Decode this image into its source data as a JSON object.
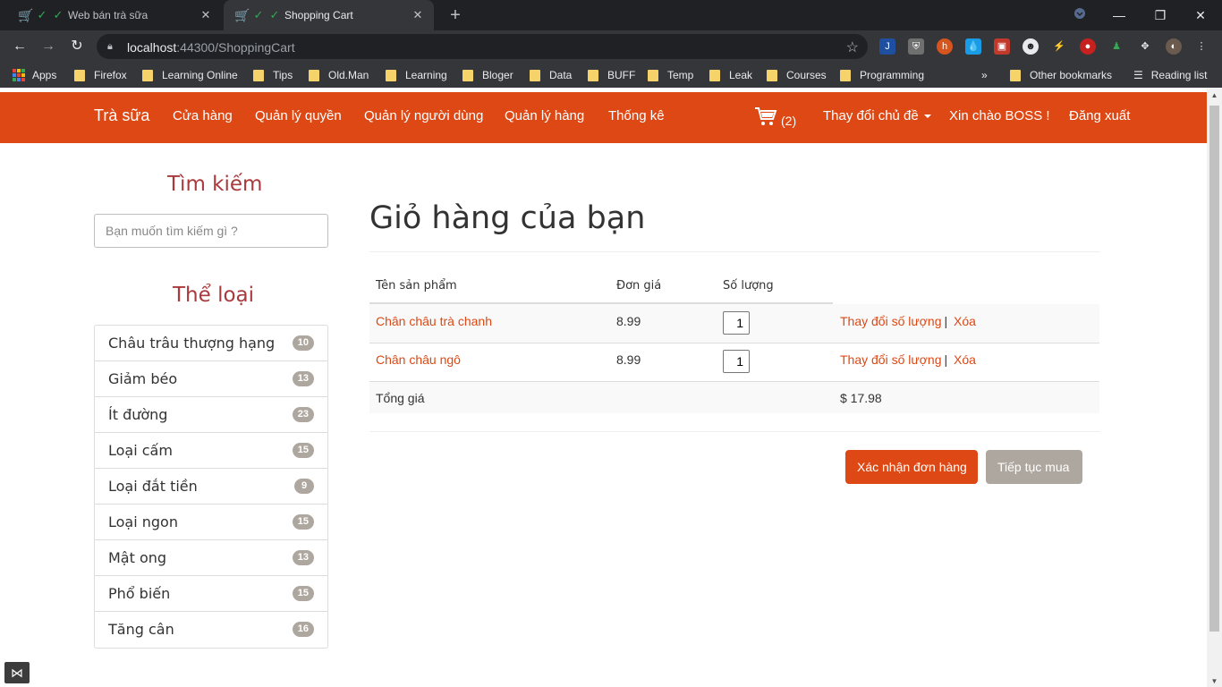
{
  "browser": {
    "tabs": [
      {
        "title": "Web bán trà sữa",
        "active": false
      },
      {
        "title": "Shopping Cart",
        "active": true
      }
    ],
    "url_host": "localhost",
    "url_path": ":44300/ShoppingCart",
    "bookmarks": [
      "Apps",
      "Firefox",
      "Learning Online",
      "Tips",
      "Old.Man",
      "Learning",
      "Bloger",
      "Data",
      "BUFF",
      "Temp",
      "Leak",
      "Courses",
      "Programming"
    ],
    "more_bookmarks": "»",
    "other_bookmarks": "Other bookmarks",
    "reading_list": "Reading list"
  },
  "navbar": {
    "brand": "Trà sữa",
    "links": [
      "Cửa hàng",
      "Quản lý quyền",
      "Quản lý người dùng",
      "Quản lý hàng",
      "Thống kê"
    ],
    "cart_count": "(2)",
    "theme_label": "Thay đổi chủ đề",
    "greeting": "Xin chào BOSS !",
    "logout": "Đăng xuất",
    "color": "#dd4814"
  },
  "sidebar": {
    "search_title": "Tìm kiếm",
    "search_placeholder": "Bạn muốn tìm kiếm gì ?",
    "category_title": "Thể loại",
    "categories": [
      {
        "label": "Châu trâu thượng hạng",
        "count": "10"
      },
      {
        "label": "Giảm béo",
        "count": "13"
      },
      {
        "label": "Ít đường",
        "count": "23"
      },
      {
        "label": "Loại cấm",
        "count": "15"
      },
      {
        "label": "Loại đắt tiền",
        "count": "9"
      },
      {
        "label": "Loại ngon",
        "count": "15"
      },
      {
        "label": "Mật ong",
        "count": "13"
      },
      {
        "label": "Phổ biến",
        "count": "15"
      },
      {
        "label": "Tăng cân",
        "count": "16"
      }
    ]
  },
  "cart": {
    "title": "Giỏ hàng của bạn",
    "headers": {
      "name": "Tên sản phẩm",
      "price": "Đơn giá",
      "qty": "Số lượng"
    },
    "items": [
      {
        "name": "Chân châu trà chanh",
        "price": "8.99",
        "qty": "1",
        "update": "Thay đổi số lượng",
        "remove": "Xóa"
      },
      {
        "name": "Chân châu ngô",
        "price": "8.99",
        "qty": "1",
        "update": "Thay đổi số lượng",
        "remove": "Xóa"
      }
    ],
    "total_label": "Tổng giá",
    "total_value": "$ 17.98",
    "confirm_button": "Xác nhận đơn hàng",
    "continue_button": "Tiếp tục mua"
  }
}
